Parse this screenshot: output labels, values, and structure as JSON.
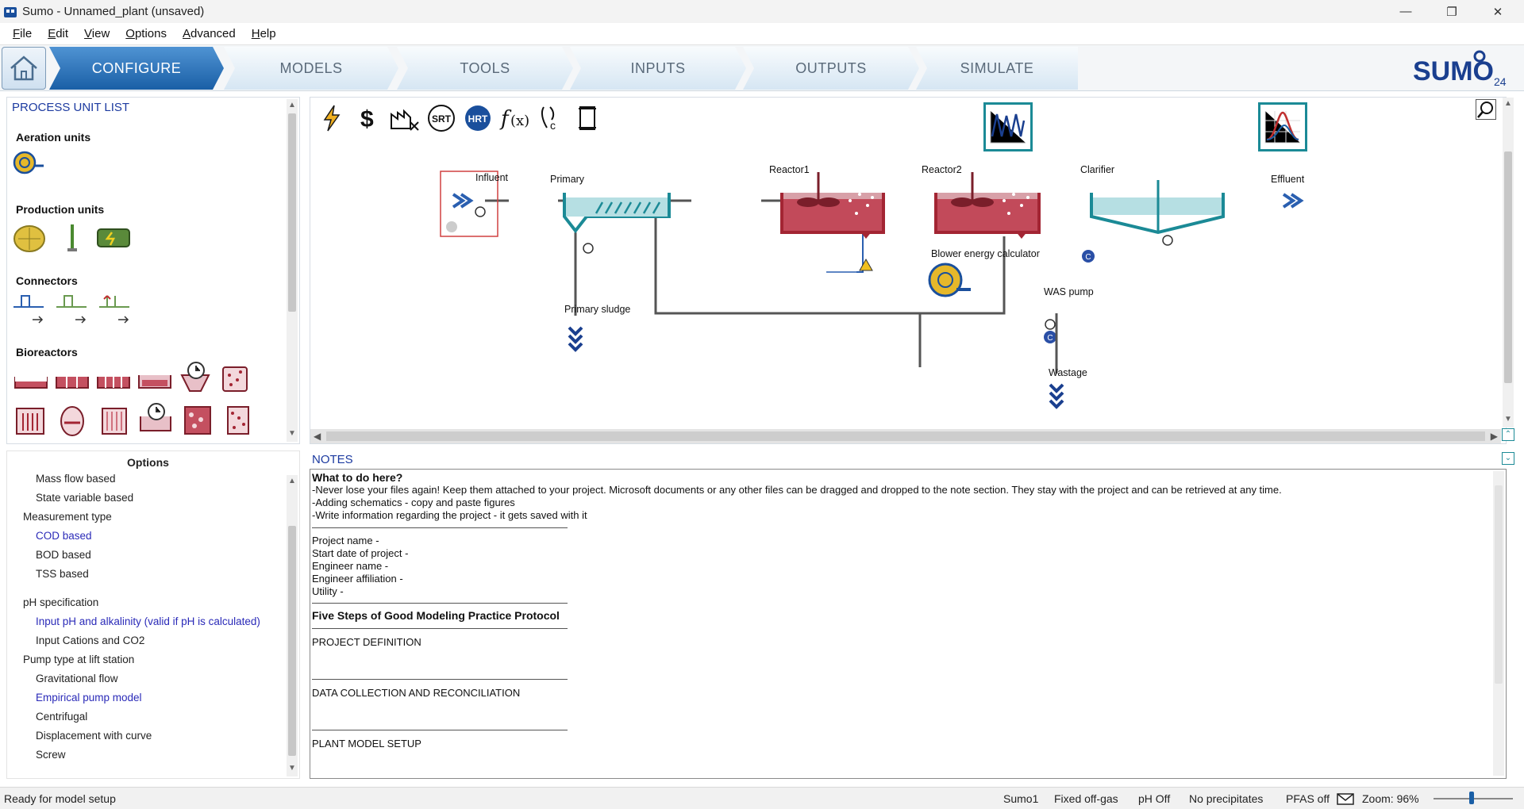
{
  "window": {
    "title": "Sumo - Unnamed_plant (unsaved)"
  },
  "menu": [
    "File",
    "Edit",
    "View",
    "Options",
    "Advanced",
    "Help"
  ],
  "ribbon": {
    "tabs": [
      "CONFIGURE",
      "MODELS",
      "TOOLS",
      "INPUTS",
      "OUTPUTS",
      "SIMULATE"
    ],
    "active_tab": "CONFIGURE",
    "logo_text": "SUMO",
    "logo_version": "24"
  },
  "process_unit_list": {
    "header": "PROCESS UNIT LIST",
    "sections": [
      "Aeration units",
      "Production units",
      "Connectors",
      "Bioreactors"
    ]
  },
  "options": {
    "title": "Options",
    "items": [
      {
        "label": "Mass flow based",
        "level": 2,
        "selected": false
      },
      {
        "label": "State variable based",
        "level": 2,
        "selected": false
      },
      {
        "label": "Measurement type",
        "level": 1,
        "selected": false
      },
      {
        "label": "COD based",
        "level": 2,
        "selected": true
      },
      {
        "label": "BOD based",
        "level": 2,
        "selected": false
      },
      {
        "label": "TSS based",
        "level": 2,
        "selected": false
      },
      {
        "label": "pH specification",
        "level": 1,
        "selected": false
      },
      {
        "label": "Input pH and alkalinity (valid if pH is calculated)",
        "level": 2,
        "selected": true
      },
      {
        "label": "Input Cations and CO2",
        "level": 2,
        "selected": false
      },
      {
        "label": "Pump type at lift station",
        "level": 1,
        "selected": false
      },
      {
        "label": "Gravitational flow",
        "level": 2,
        "selected": false
      },
      {
        "label": "Empirical pump model",
        "level": 2,
        "selected": true
      },
      {
        "label": "Centrifugal",
        "level": 2,
        "selected": false
      },
      {
        "label": "Displacement with curve",
        "level": 2,
        "selected": false
      },
      {
        "label": "Screw",
        "level": 2,
        "selected": false
      }
    ]
  },
  "canvas": {
    "toolbar_texts": {
      "srt": "SRT",
      "hrt": "HRT"
    },
    "units": {
      "influent": "Influent",
      "primary": "Primary",
      "reactor1": "Reactor1",
      "reactor2": "Reactor2",
      "clarifier": "Clarifier",
      "effluent": "Effluent",
      "blower": "Blower energy calculator",
      "was_pump": "WAS pump",
      "primary_sludge": "Primary sludge",
      "wastage": "Wastage"
    }
  },
  "notes": {
    "header": "NOTES",
    "lines": [
      {
        "text": "What to do here?",
        "bold": true
      },
      {
        "text": "-Never lose your files again! Keep them attached to your project. Microsoft documents or any other files can be dragged and dropped to the note section. They stay with the project and can be retrieved at any time.",
        "bold": false
      },
      {
        "text": "-Adding schematics - copy and paste figures",
        "bold": false
      },
      {
        "text": "-Write information regarding the project - it gets saved with it",
        "bold": false
      },
      {
        "text": "Project name -",
        "bold": false
      },
      {
        "text": "Start date of project -",
        "bold": false
      },
      {
        "text": "Engineer name -",
        "bold": false
      },
      {
        "text": "Engineer affiliation -",
        "bold": false
      },
      {
        "text": "Utility -",
        "bold": false
      },
      {
        "text": "Five Steps of Good Modeling Practice Protocol",
        "bold": true
      },
      {
        "text": "PROJECT DEFINITION",
        "bold": false
      },
      {
        "text": "DATA COLLECTION AND RECONCILIATION",
        "bold": false
      },
      {
        "text": "PLANT MODEL SETUP",
        "bold": false
      }
    ]
  },
  "status": {
    "message": "Ready for model setup",
    "model": "Sumo1",
    "offgas": "Fixed off-gas",
    "ph": "pH Off",
    "precipitates": "No precipitates",
    "pfas": "PFAS off",
    "zoom": "Zoom: 96%",
    "zoom_value_percent": 96
  },
  "colors": {
    "accent": "#1a5fa6",
    "reactor": "#a32533",
    "clarifier": "#1b8a96",
    "link_blue": "#2a2ab8"
  }
}
